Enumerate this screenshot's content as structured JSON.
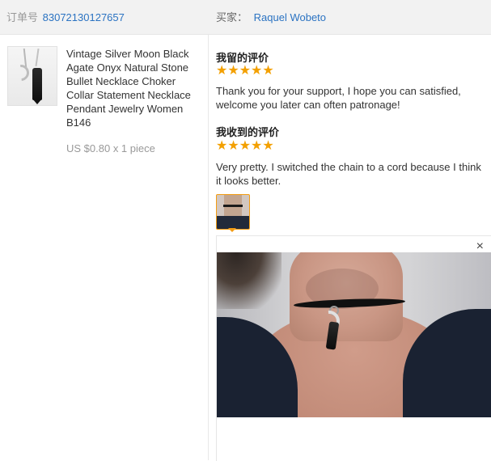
{
  "header": {
    "order_label": "订单号",
    "order_number": "83072130127657",
    "buyer_label": "买家：",
    "buyer_name": "Raquel Wobeto"
  },
  "product": {
    "title": "Vintage Silver Moon Black Agate Onyx Natural Stone Bullet Necklace Choker Collar Statement Necklace Pendant Jewelry Women B146",
    "price": "US $0.80 x 1 piece"
  },
  "my_review": {
    "title": "我留的评价",
    "rating": 5,
    "text": "Thank you for your support, I hope you can satisfied, welcome you later can often patronage!"
  },
  "received_review": {
    "title": "我收到的评价",
    "rating": 5,
    "text": "Very pretty. I switched the chain to a cord because I think it looks better."
  },
  "photo_viewer": {
    "close_label": "×"
  },
  "colors": {
    "link": "#2b73c2",
    "star": "#f3a000",
    "thumb_border": "#f39c12"
  }
}
